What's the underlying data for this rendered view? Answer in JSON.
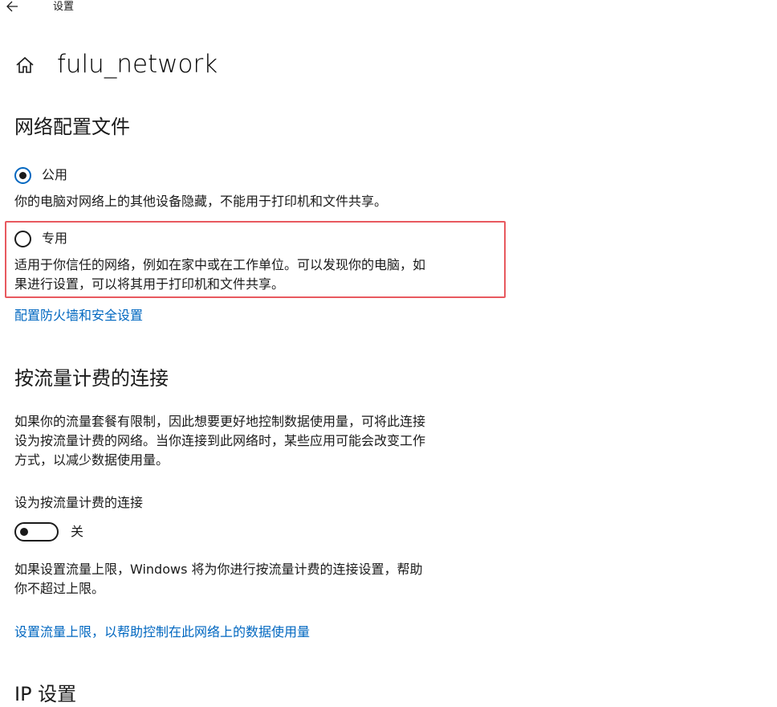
{
  "header": {
    "app_title": "设置",
    "back_icon": "arrow-left-icon",
    "home_icon": "home-icon",
    "page_title": "fulu_network"
  },
  "network_profile": {
    "heading": "网络配置文件",
    "options": [
      {
        "label": "公用",
        "selected": true,
        "description": "你的电脑对网络上的其他设备隐藏，不能用于打印机和文件共享。"
      },
      {
        "label": "专用",
        "selected": false,
        "description_line1": "适用于你信任的网络，例如在家中或在工作单位。可以发现你的电脑，如",
        "description_line2": "果进行设置，可以将其用于打印机和文件共享。"
      }
    ],
    "firewall_link": "配置防火墙和安全设置"
  },
  "metered": {
    "heading": "按流量计费的连接",
    "desc_line1": "如果你的流量套餐有限制，因此想要更好地控制数据使用量，可将此连接",
    "desc_line2": "设为按流量计费的网络。当你连接到此网络时，某些应用可能会改变工作",
    "desc_line3": "方式，以减少数据使用量。",
    "toggle_label": "设为按流量计费的连接",
    "toggle_on": false,
    "toggle_state": "关",
    "limit_desc_line1": "如果设置流量上限，Windows 将为你进行按流量计费的连接设置，帮助",
    "limit_desc_line2": "你不超过上限。",
    "limit_link": "设置流量上限，以帮助控制在此网络上的数据使用量"
  },
  "ip_settings": {
    "heading": "IP 设置"
  },
  "colors": {
    "accent": "#0067c0",
    "highlight": "#e8595f",
    "text": "#1a1a1a",
    "background": "#ffffff"
  }
}
